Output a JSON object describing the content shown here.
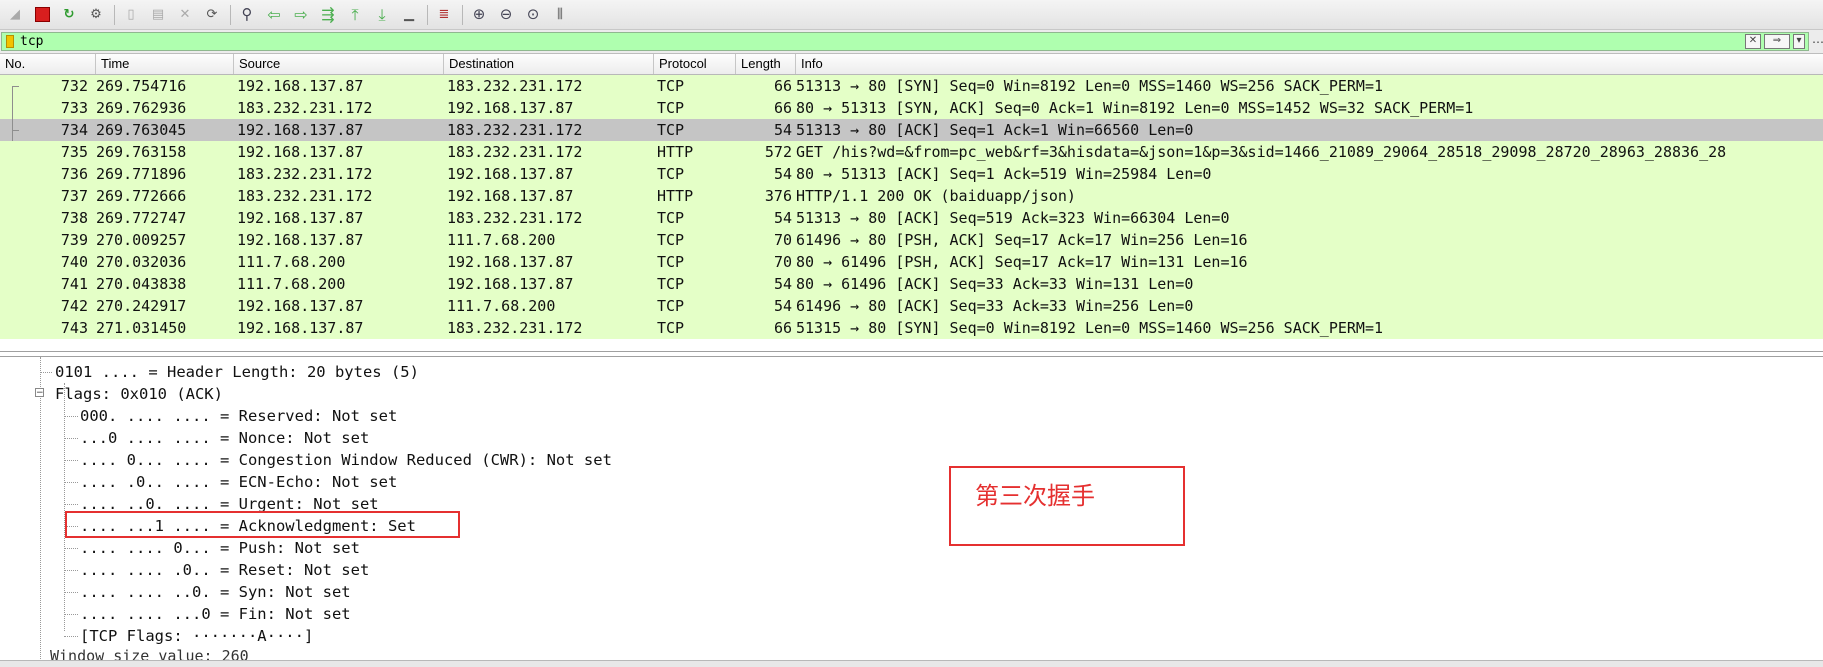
{
  "filter": {
    "value": "tcp"
  },
  "columns": [
    "No.",
    "Time",
    "Source",
    "Destination",
    "Protocol",
    "Length",
    "Info"
  ],
  "packets": [
    {
      "no": "732",
      "time": "269.754716",
      "src": "192.168.137.87",
      "dst": "183.232.231.172",
      "proto": "TCP",
      "len": "66",
      "info": "51313 → 80 [SYN] Seq=0 Win=8192 Len=0 MSS=1460 WS=256 SACK_PERM=1"
    },
    {
      "no": "733",
      "time": "269.762936",
      "src": "183.232.231.172",
      "dst": "192.168.137.87",
      "proto": "TCP",
      "len": "66",
      "info": "80 → 51313 [SYN, ACK] Seq=0 Ack=1 Win=8192 Len=0 MSS=1452 WS=32 SACK_PERM=1"
    },
    {
      "no": "734",
      "time": "269.763045",
      "src": "192.168.137.87",
      "dst": "183.232.231.172",
      "proto": "TCP",
      "len": "54",
      "info": "51313 → 80 [ACK] Seq=1 Ack=1 Win=66560 Len=0"
    },
    {
      "no": "735",
      "time": "269.763158",
      "src": "192.168.137.87",
      "dst": "183.232.231.172",
      "proto": "HTTP",
      "len": "572",
      "info": "GET /his?wd=&from=pc_web&rf=3&hisdata=&json=1&p=3&sid=1466_21089_29064_28518_29098_28720_28963_28836_28"
    },
    {
      "no": "736",
      "time": "269.771896",
      "src": "183.232.231.172",
      "dst": "192.168.137.87",
      "proto": "TCP",
      "len": "54",
      "info": "80 → 51313 [ACK] Seq=1 Ack=519 Win=25984 Len=0"
    },
    {
      "no": "737",
      "time": "269.772666",
      "src": "183.232.231.172",
      "dst": "192.168.137.87",
      "proto": "HTTP",
      "len": "376",
      "info": "HTTP/1.1 200 OK  (baiduapp/json)"
    },
    {
      "no": "738",
      "time": "269.772747",
      "src": "192.168.137.87",
      "dst": "183.232.231.172",
      "proto": "TCP",
      "len": "54",
      "info": "51313 → 80 [ACK] Seq=519 Ack=323 Win=66304 Len=0"
    },
    {
      "no": "739",
      "time": "270.009257",
      "src": "192.168.137.87",
      "dst": "111.7.68.200",
      "proto": "TCP",
      "len": "70",
      "info": "61496 → 80 [PSH, ACK] Seq=17 Ack=17 Win=256 Len=16"
    },
    {
      "no": "740",
      "time": "270.032036",
      "src": "111.7.68.200",
      "dst": "192.168.137.87",
      "proto": "TCP",
      "len": "70",
      "info": "80 → 61496 [PSH, ACK] Seq=17 Ack=17 Win=131 Len=16"
    },
    {
      "no": "741",
      "time": "270.043838",
      "src": "111.7.68.200",
      "dst": "192.168.137.87",
      "proto": "TCP",
      "len": "54",
      "info": "80 → 61496 [ACK] Seq=33 Ack=33 Win=131 Len=0"
    },
    {
      "no": "742",
      "time": "270.242917",
      "src": "192.168.137.87",
      "dst": "111.7.68.200",
      "proto": "TCP",
      "len": "54",
      "info": "61496 → 80 [ACK] Seq=33 Ack=33 Win=256 Len=0"
    },
    {
      "no": "743",
      "time": "271.031450",
      "src": "192.168.137.87",
      "dst": "183.232.231.172",
      "proto": "TCP",
      "len": "66",
      "info": "51315 → 80 [SYN] Seq=0 Win=8192 Len=0 MSS=1460 WS=256 SACK_PERM=1"
    }
  ],
  "details": {
    "header_length": "0101 .... = Header Length: 20 bytes (5)",
    "flags": "Flags: 0x010 (ACK)",
    "flag_lines": [
      "000. .... .... = Reserved: Not set",
      "...0 .... .... = Nonce: Not set",
      ".... 0... .... = Congestion Window Reduced (CWR): Not set",
      ".... .0.. .... = ECN-Echo: Not set",
      ".... ..0. .... = Urgent: Not set",
      ".... ...1 .... = Acknowledgment: Set",
      ".... .... 0... = Push: Not set",
      ".... .... .0.. = Reset: Not set",
      ".... .... ..0. = Syn: Not set",
      ".... .... ...0 = Fin: Not set",
      "[TCP Flags: ·······A····]"
    ],
    "cut_off": "Window size value: 260"
  },
  "annotation": {
    "note": "第三次握手"
  }
}
